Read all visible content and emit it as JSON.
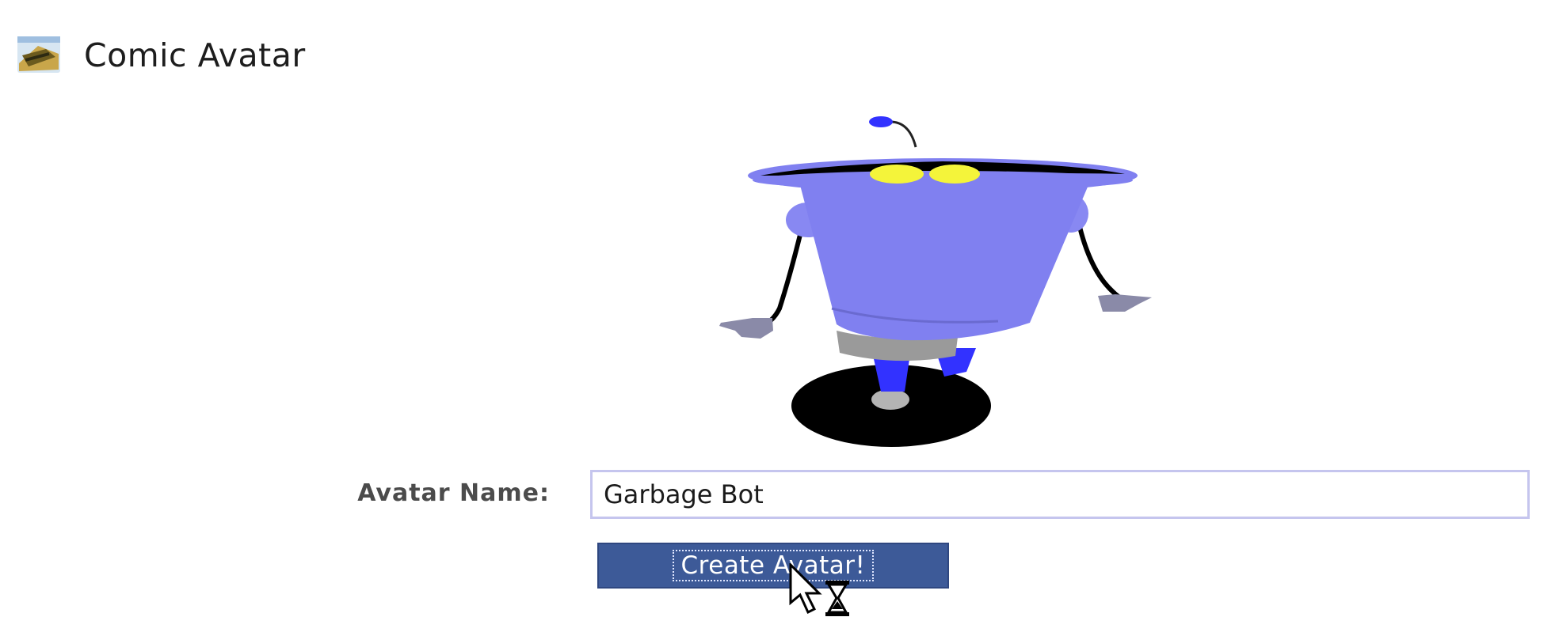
{
  "header": {
    "title": "Comic Avatar",
    "icon": "comic-avatar-app-icon"
  },
  "avatar": {
    "description_icon": "robot-avatar-image",
    "colors": {
      "body": "#8080f0",
      "eyes": "#f4f43a",
      "base": "#000000",
      "belt": "#9a9a9a",
      "feet": "#3232ff"
    }
  },
  "form": {
    "name_label": "Avatar Name:",
    "name_value": "Garbage Bot",
    "submit_label": "Create Avatar!"
  },
  "colors": {
    "button_bg": "#3d5a98",
    "input_border": "#c5c5ee",
    "label_text": "#4b4b4b"
  },
  "cursor": {
    "icon": "busy-arrow-cursor-icon"
  }
}
